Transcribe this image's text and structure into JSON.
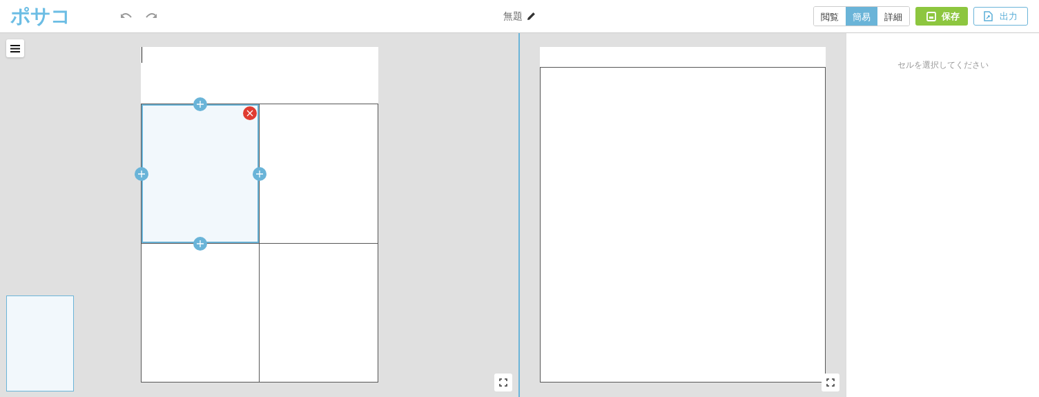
{
  "logo": "ポサコ",
  "document_title": "無題",
  "view_modes": [
    {
      "label": "閲覧",
      "selected": false
    },
    {
      "label": "簡易",
      "selected": true
    },
    {
      "label": "詳細",
      "selected": false
    }
  ],
  "save_button": "保存",
  "export_button": "出力",
  "editor": {
    "cells": [
      {
        "selected": true
      },
      {
        "selected": false
      },
      {
        "selected": false
      },
      {
        "selected": false
      }
    ]
  },
  "properties_panel": {
    "hint": "セルを選択してください"
  }
}
